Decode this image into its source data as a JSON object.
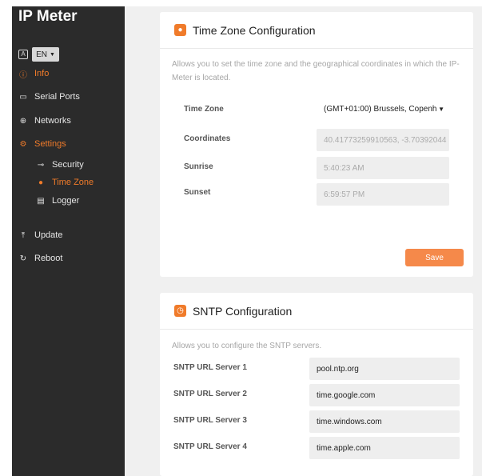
{
  "app": {
    "title": "IP Meter"
  },
  "language": {
    "icon": "translate-icon",
    "selected": "EN"
  },
  "sidebar": {
    "items": [
      {
        "label": "Info",
        "icon": "info-icon"
      },
      {
        "label": "Serial Ports",
        "icon": "serial-port-icon"
      },
      {
        "label": "Networks",
        "icon": "globe-icon"
      },
      {
        "label": "Settings",
        "icon": "gear-icon"
      },
      {
        "label": "Update",
        "icon": "upload-icon"
      },
      {
        "label": "Reboot",
        "icon": "power-icon"
      }
    ],
    "subitems": [
      {
        "label": "Security",
        "icon": "key-icon"
      },
      {
        "label": "Time Zone",
        "icon": "globe-icon"
      },
      {
        "label": "Logger",
        "icon": "document-icon"
      }
    ],
    "active_item": "Settings",
    "active_subitem": "Time Zone"
  },
  "timezone": {
    "title": "Time Zone Configuration",
    "description": "Allows you to set the time zone and the geographical coordinates in which the IP-Meter is located.",
    "fields": {
      "timezone_label": "Time Zone",
      "timezone_value": "(GMT+01:00) Brussels, Copenh",
      "coordinates_label": "Coordinates",
      "coordinates_value": "40.41773259910563, -3.70392044",
      "sunrise_label": "Sunrise",
      "sunrise_value": "5:40:23 AM",
      "sunset_label": "Sunset",
      "sunset_value": "6:59:57 PM"
    },
    "save_label": "Save"
  },
  "sntp": {
    "title": "SNTP Configuration",
    "description": "Allows you to configure the SNTP servers.",
    "servers": [
      {
        "label": "SNTP URL Server 1",
        "value": "pool.ntp.org"
      },
      {
        "label": "SNTP URL Server 2",
        "value": "time.google.com"
      },
      {
        "label": "SNTP URL Server 3",
        "value": "time.windows.com"
      },
      {
        "label": "SNTP URL Server 4",
        "value": "time.apple.com"
      }
    ]
  },
  "colors": {
    "accent": "#f07b2a",
    "sidebar_bg": "#2b2b2b",
    "main_bg": "#f0f0f0"
  }
}
